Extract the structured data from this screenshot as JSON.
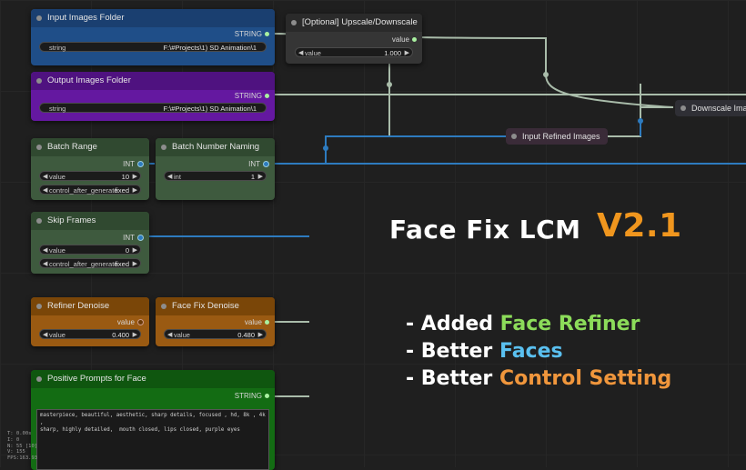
{
  "colors": {
    "blue_node": "#1f4e88",
    "blue_header": "#1a3f70",
    "purple_node": "#6418a0",
    "purple_header": "#4f1280",
    "green_node": "#3e5a3e",
    "green_header": "#304930",
    "orange_node": "#9a5a12",
    "orange_header": "#7a4608",
    "bright_green_node": "#136c13",
    "bright_green_header": "#0f560f",
    "version": "#f0961e",
    "accent_green": "#8cdc5a",
    "accent_blue": "#5ac0f0",
    "accent_orange": "#f0963c",
    "wire_string": "#a9bcaa",
    "wire_int": "#2d7bbf"
  },
  "nodes": {
    "input_images_folder": {
      "title": "Input Images Folder",
      "output": "STRING",
      "field_label": "string",
      "field_value": "F:\\#Projects\\1) SD Animation\\1"
    },
    "output_images_folder": {
      "title": "Output Images Folder",
      "output": "STRING",
      "field_label": "string",
      "field_value": "F:\\#Projects\\1) SD Animation\\1"
    },
    "upscale": {
      "title": "[Optional] Upscale/Downscale",
      "output": "value",
      "field_label": "value",
      "field_value": "1.000"
    },
    "batch_range": {
      "title": "Batch Range",
      "output": "INT",
      "field_label": "value",
      "field_value": "10",
      "control_label": "control_after_generate",
      "control_value": "fixed"
    },
    "batch_number_naming": {
      "title": "Batch Number Naming",
      "output": "INT",
      "field_label": "int",
      "field_value": "1"
    },
    "skip_frames": {
      "title": "Skip Frames",
      "output": "INT",
      "field_label": "value",
      "field_value": "0",
      "control_label": "control_after_generate",
      "control_value": "fixed"
    },
    "refiner_denoise": {
      "title": "Refiner Denoise",
      "output": "value",
      "field_label": "value",
      "field_value": "0.400"
    },
    "face_fix_denoise": {
      "title": "Face Fix Denoise",
      "output": "value",
      "field_label": "value",
      "field_value": "0.480"
    },
    "positive_prompts": {
      "title": "Positive Prompts for Face",
      "output": "STRING",
      "text": "masterpiece, beautiful, aesthetic, sharp details, focused , hd, 8k , 4k ,\nsharp, highly detailed,  mouth closed, lips closed, purple eyes"
    },
    "input_refined_images": {
      "title": "Input Refined Images"
    },
    "downscale": {
      "title": "Downscale Ima"
    }
  },
  "promo": {
    "title": "Face Fix LCM",
    "version": "V2.1",
    "features": [
      {
        "prefix": "- Added ",
        "highlight": "Face Refiner"
      },
      {
        "prefix": "- Better ",
        "highlight": "Faces"
      },
      {
        "prefix": "- Better ",
        "highlight": "Control Setting"
      }
    ]
  },
  "stats": [
    "T: 0.00s",
    "I: 0",
    "N: 55 [10]",
    "V: 155",
    "FPS:163.93"
  ]
}
